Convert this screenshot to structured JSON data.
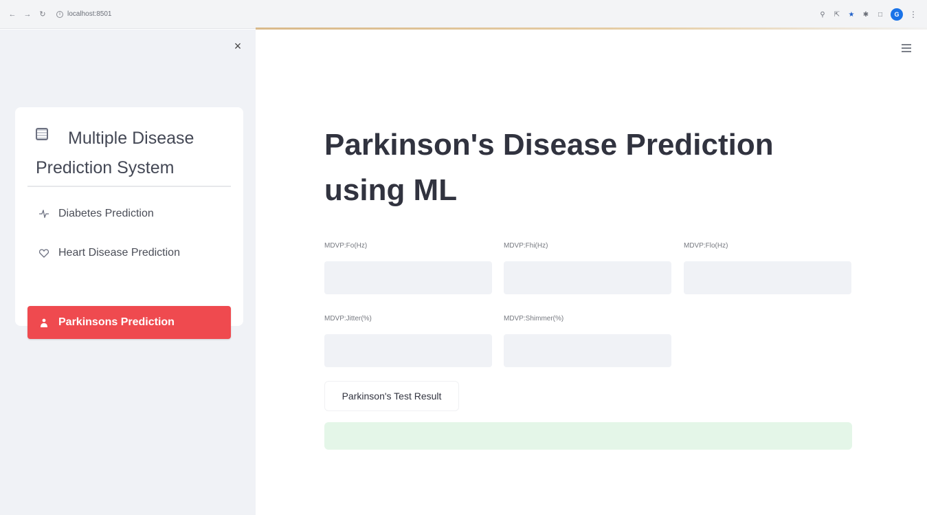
{
  "browser": {
    "url": "localhost:8501",
    "back_icon": "arrow-left-icon",
    "forward_icon": "arrow-right-icon",
    "reload_icon": "reload-icon",
    "profile_initial": "G"
  },
  "sidebar": {
    "close_icon": "close-icon",
    "title": "Multiple Disease Prediction System",
    "title_icon": "app-icon",
    "items": [
      {
        "label": "Diabetes Prediction",
        "icon": "activity-icon",
        "active": false
      },
      {
        "label": "Heart Disease Prediction",
        "icon": "heart-icon",
        "active": false
      },
      {
        "label": "Parkinsons Prediction",
        "icon": "person-icon",
        "active": true
      }
    ],
    "active_color": "#ef4a4f"
  },
  "main": {
    "title": "Parkinson's Disease Prediction using ML",
    "fields": [
      {
        "label": "MDVP:Fo(Hz)",
        "value": ""
      },
      {
        "label": "MDVP:Fhi(Hz)",
        "value": ""
      },
      {
        "label": "MDVP:Flo(Hz)",
        "value": ""
      },
      {
        "label": "MDVP:Jitter(%)",
        "value": ""
      },
      {
        "label": "MDVP:Shimmer(%)",
        "value": ""
      }
    ],
    "submit_label": "Parkinson's Test Result",
    "result_text": ""
  }
}
